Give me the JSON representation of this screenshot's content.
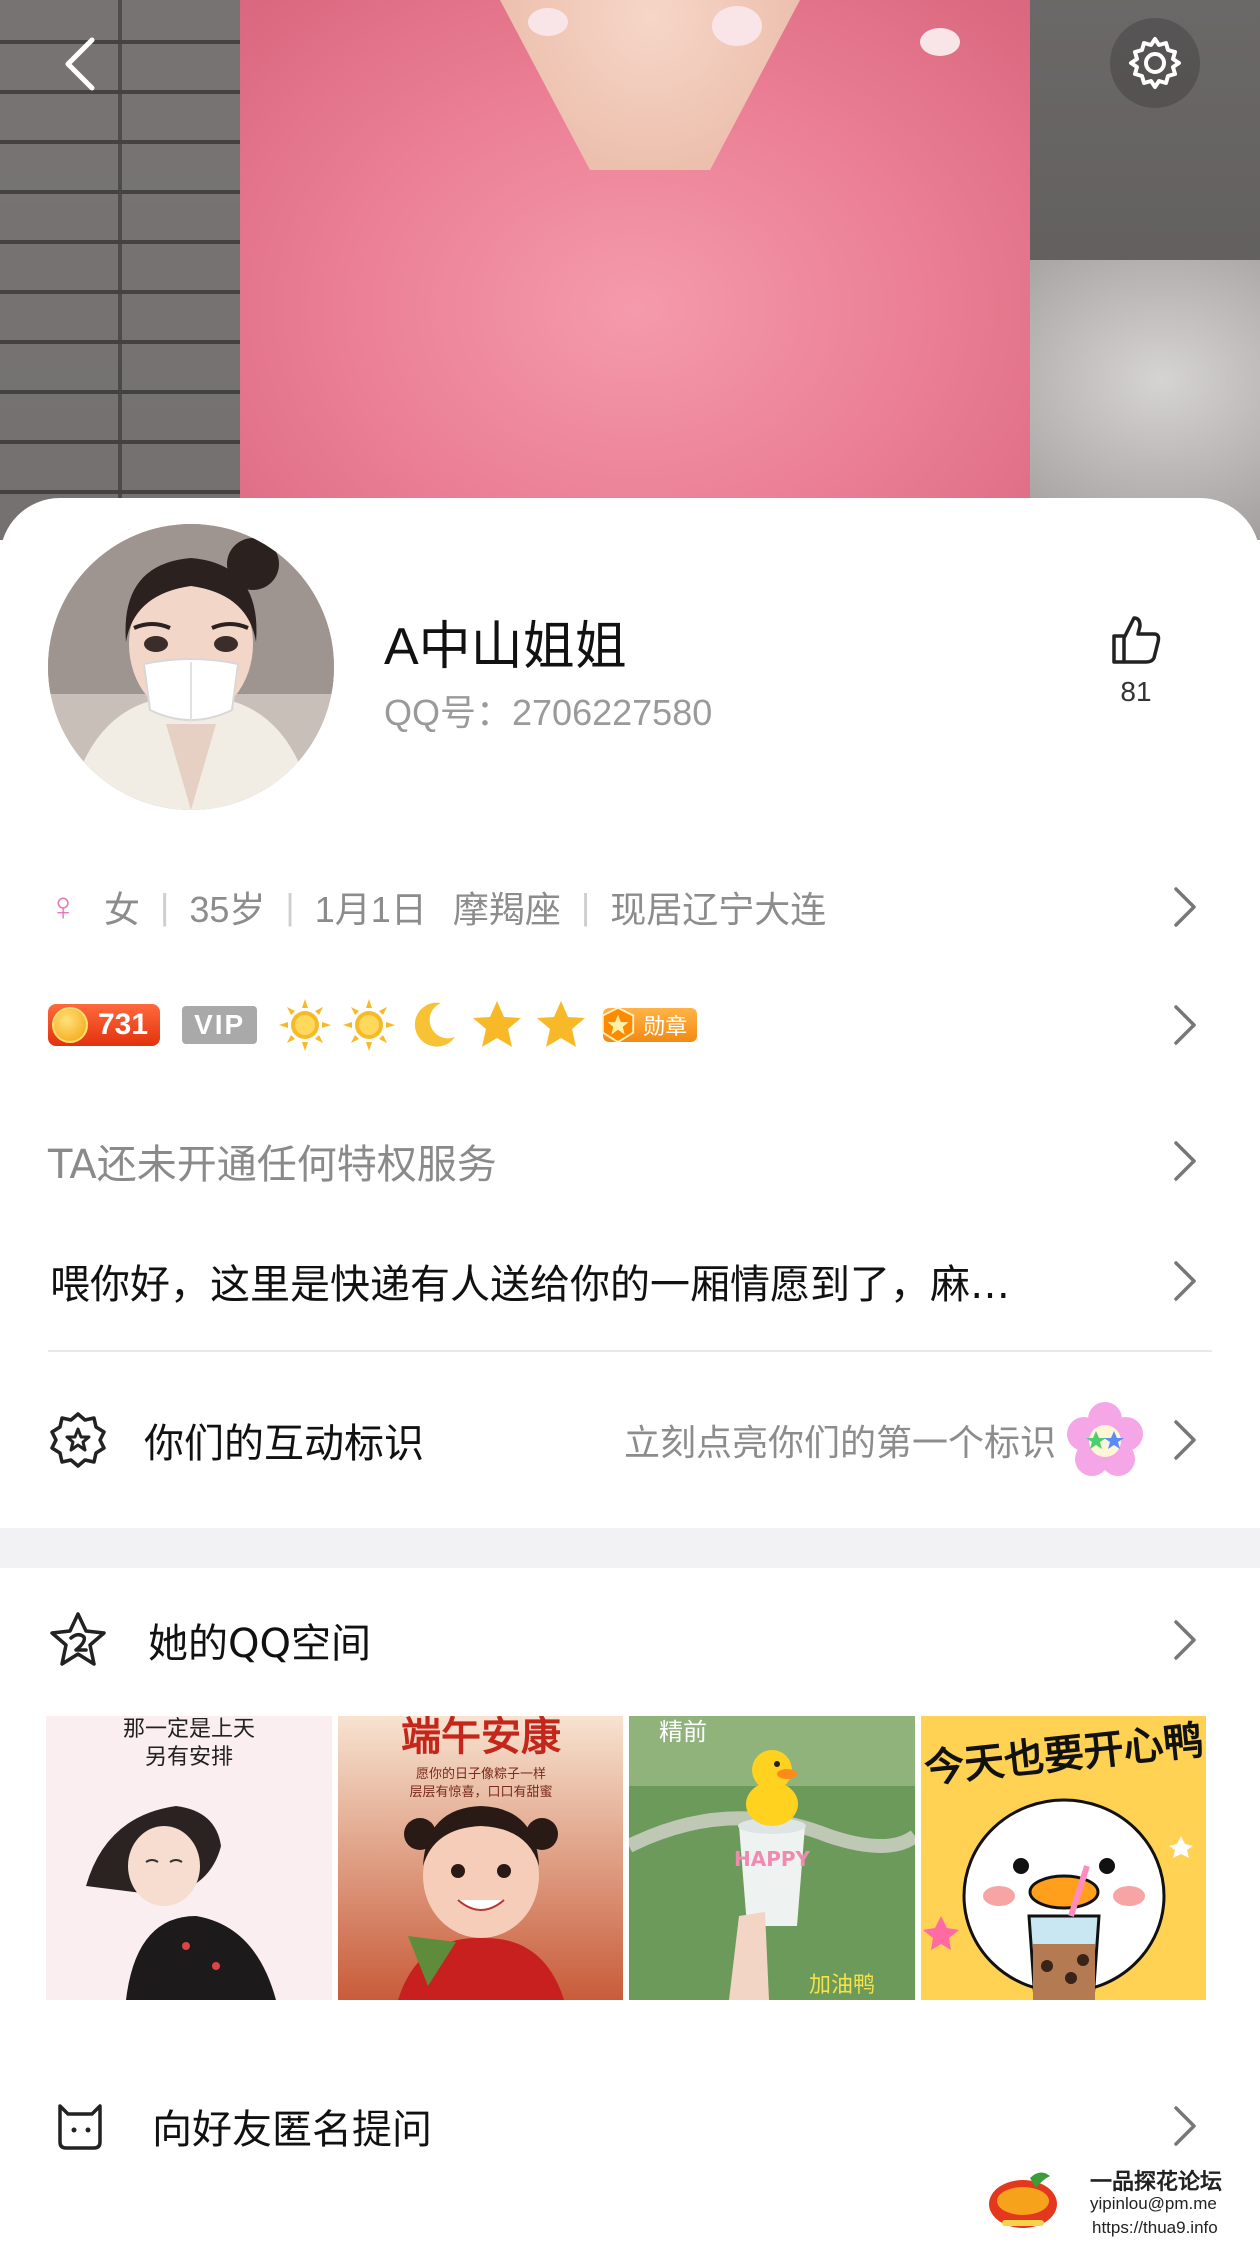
{
  "profile": {
    "name": "A中山姐姐",
    "qq_label": "QQ号：",
    "qq_number": "2706227580",
    "likes": "81"
  },
  "info": {
    "gender_symbol": "♀",
    "gender": "女",
    "age": "35岁",
    "birthday": "1月1日",
    "zodiac": "摩羯座",
    "location": "现居辽宁大连",
    "separator": "|"
  },
  "badges": {
    "level": "731",
    "vip": "VIP",
    "level_icons": [
      "sun-icon",
      "sun-icon",
      "moon-icon",
      "star-icon",
      "star-icon"
    ],
    "medal_label": "勋章"
  },
  "privilege": {
    "text": "TA还未开通任何特权服务"
  },
  "signature": {
    "text": "喂你好，这里是快递有人送给你的一厢情愿到了，麻…"
  },
  "interaction": {
    "title": "你们的互动标识",
    "hint": "立刻点亮你们的第一个标识"
  },
  "qzone": {
    "title": "她的QQ空间",
    "photos": [
      {
        "caption_line1": "那一定是上天",
        "caption_line2": "另有安排"
      },
      {
        "caption_title": "端午安康",
        "caption_sub1": "愿你的日子像粽子一样",
        "caption_sub2": "层层有惊喜，口口有甜蜜"
      },
      {
        "caption_top": "精前",
        "cup_text": "HAPPY",
        "caption_bottom": "加油鸭"
      },
      {
        "caption_title": "今天也要开心鸭"
      }
    ]
  },
  "ask": {
    "title": "向好友匿名提问"
  },
  "watermark": {
    "title": "一品探花论坛",
    "email": "yipinlou@pm.me",
    "url": "https://thua9.info"
  },
  "colors": {
    "accent_pink": "#e879b9",
    "level_red": "#e2320e",
    "vip_gray": "#a9a9a9",
    "medal_orange": "#f28a13",
    "muted_text": "#8c8c8c"
  }
}
